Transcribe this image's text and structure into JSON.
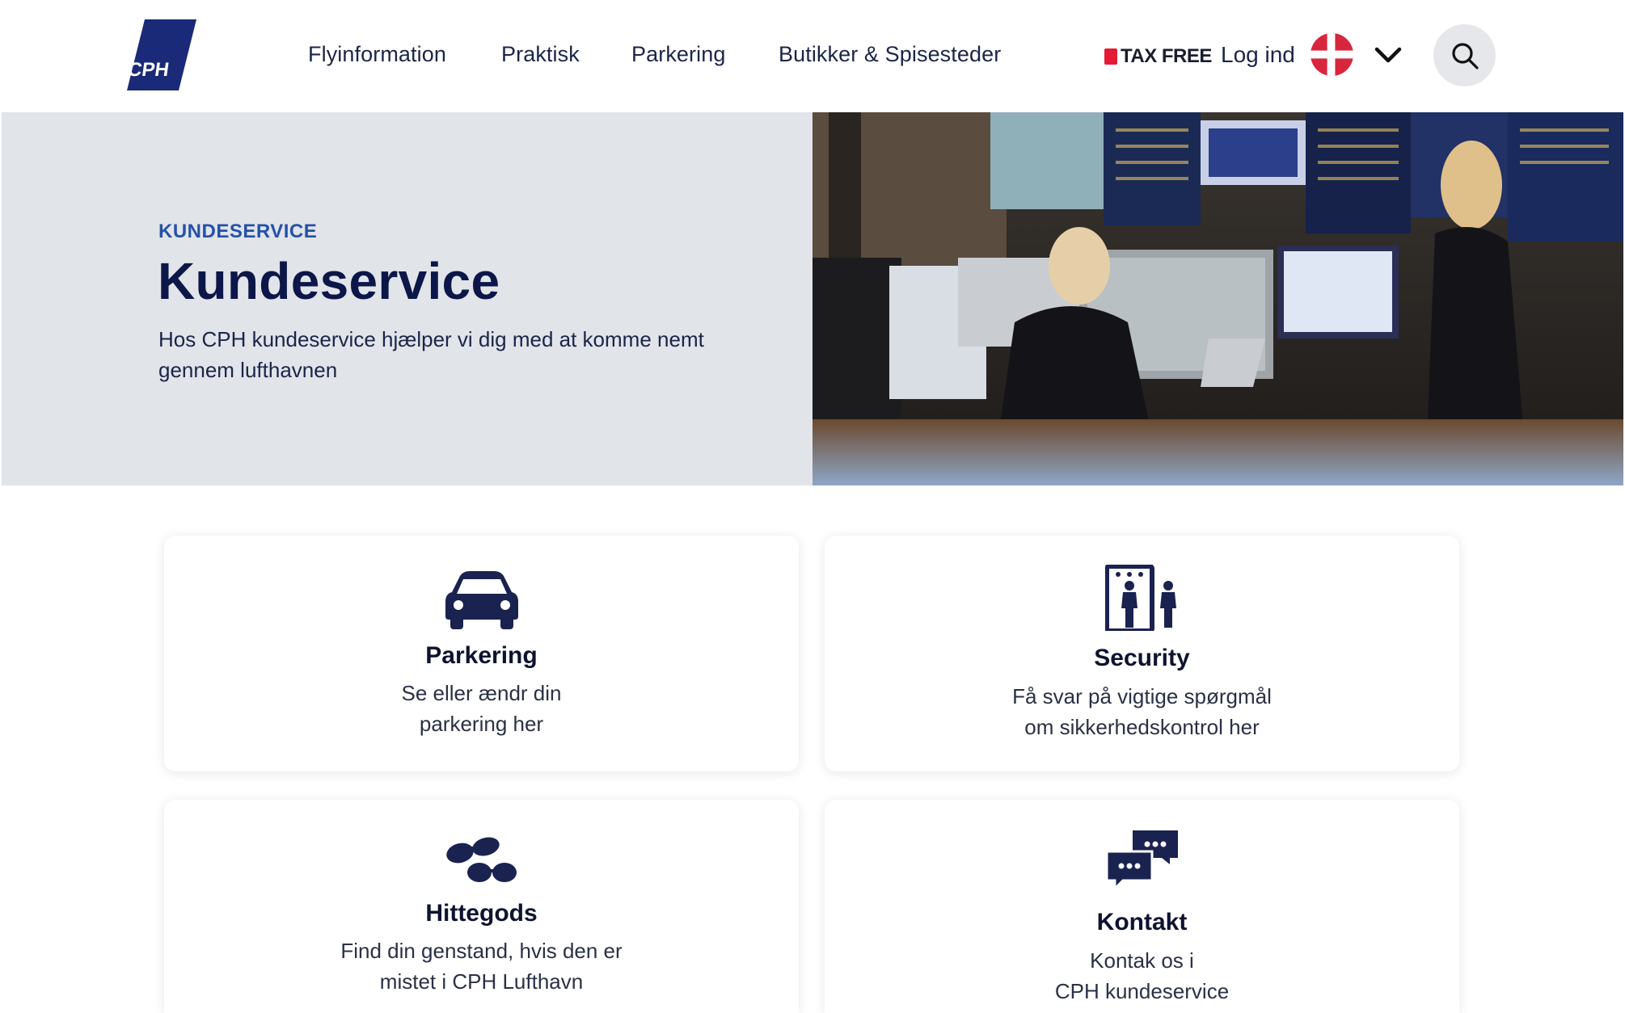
{
  "header": {
    "logo_text": "CPH",
    "nav": [
      "Flyinformation",
      "Praktisk",
      "Parkering",
      "Butikker & Spisesteder"
    ],
    "taxfree_label": "TAX FREE",
    "login_label": "Log ind",
    "language": "Dansk",
    "colors": {
      "brand_navy": "#1a2a78",
      "flag_red": "#d7263d"
    }
  },
  "hero": {
    "eyebrow": "KUNDESERVICE",
    "title": "Kundeservice",
    "subtitle": "Hos CPH kundeservice hjælper vi dig med at komme nemt gennem lufthavnen"
  },
  "cards": [
    {
      "icon": "car-icon",
      "title": "Parkering",
      "desc_line1": "Se eller ændr din",
      "desc_line2": "parkering her"
    },
    {
      "icon": "security-gate-icon",
      "title": "Security",
      "desc_line1": "Få svar på vigtige spørgmål",
      "desc_line2": "om sikkerhedskontrol her"
    },
    {
      "icon": "sunglasses-icon",
      "title": "Hittegods",
      "desc_line1": "Find din genstand, hvis den er",
      "desc_line2": "mistet i CPH Lufthavn"
    },
    {
      "icon": "chat-bubbles-icon",
      "title": "Kontakt",
      "desc_line1": "Kontak os i",
      "desc_line2": "CPH kundeservice"
    }
  ]
}
